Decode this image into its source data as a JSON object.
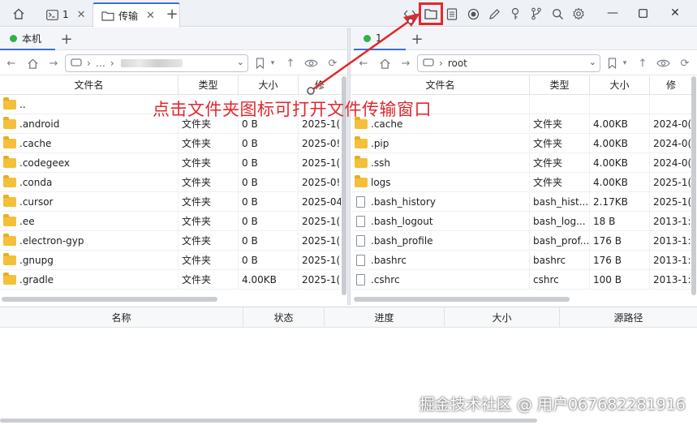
{
  "titlebar": {
    "tabs": [
      {
        "label": "1",
        "icon": "terminal-icon"
      },
      {
        "label": "传输",
        "icon": "folder-icon"
      }
    ],
    "toolbar_icons": [
      "code-icon",
      "folder-icon",
      "document-icon",
      "record-icon",
      "pencil-icon",
      "key-icon",
      "git-branch-icon",
      "search-icon",
      "gear-icon"
    ],
    "highlighted_icon": "folder-icon"
  },
  "left_pane": {
    "tab_label": "本机",
    "path": [
      "…"
    ],
    "columns": [
      "文件名",
      "类型",
      "大小",
      "修"
    ],
    "rows": [
      {
        "name": "..",
        "type": "",
        "size": "",
        "modified": "",
        "kind": "folder"
      },
      {
        "name": ".android",
        "type": "文件夹",
        "size": "0 B",
        "modified": "2025-1(",
        "kind": "folder"
      },
      {
        "name": ".cache",
        "type": "文件夹",
        "size": "0 B",
        "modified": "2025-0!",
        "kind": "folder"
      },
      {
        "name": ".codegeex",
        "type": "文件夹",
        "size": "0 B",
        "modified": "2025-1(",
        "kind": "folder"
      },
      {
        "name": ".conda",
        "type": "文件夹",
        "size": "0 B",
        "modified": "2025-0!",
        "kind": "folder"
      },
      {
        "name": ".cursor",
        "type": "文件夹",
        "size": "0 B",
        "modified": "2025-04",
        "kind": "folder"
      },
      {
        "name": ".ee",
        "type": "文件夹",
        "size": "0 B",
        "modified": "2025-1(",
        "kind": "folder"
      },
      {
        "name": ".electron-gyp",
        "type": "文件夹",
        "size": "0 B",
        "modified": "2025-1(",
        "kind": "folder"
      },
      {
        "name": ".gnupg",
        "type": "文件夹",
        "size": "0 B",
        "modified": "2025-1(",
        "kind": "folder"
      },
      {
        "name": ".gradle",
        "type": "文件夹",
        "size": "4.00KB",
        "modified": "2025-1(",
        "kind": "folder"
      }
    ]
  },
  "right_pane": {
    "tab_label": "1",
    "path": "root",
    "columns": [
      "文件名",
      "类型",
      "大小",
      "修"
    ],
    "rows": [
      {
        "name": "",
        "type": "",
        "size": "",
        "modified": "",
        "kind": "none"
      },
      {
        "name": ".cache",
        "type": "文件夹",
        "size": "4.00KB",
        "modified": "2024-0(",
        "kind": "folder"
      },
      {
        "name": ".pip",
        "type": "文件夹",
        "size": "4.00KB",
        "modified": "2024-0(",
        "kind": "folder"
      },
      {
        "name": ".ssh",
        "type": "文件夹",
        "size": "4.00KB",
        "modified": "2024-0(",
        "kind": "folder"
      },
      {
        "name": "logs",
        "type": "文件夹",
        "size": "4.00KB",
        "modified": "2025-1(",
        "kind": "folder"
      },
      {
        "name": ".bash_history",
        "type": "bash_hist...",
        "size": "2.17KB",
        "modified": "2025-1(",
        "kind": "file"
      },
      {
        "name": ".bash_logout",
        "type": "bash_log...",
        "size": "18 B",
        "modified": "2013-1:",
        "kind": "file"
      },
      {
        "name": ".bash_profile",
        "type": "bash_prof...",
        "size": "176 B",
        "modified": "2013-1:",
        "kind": "file"
      },
      {
        "name": ".bashrc",
        "type": "bashrc",
        "size": "176 B",
        "modified": "2013-1:",
        "kind": "file"
      },
      {
        "name": ".cshrc",
        "type": "cshrc",
        "size": "100 B",
        "modified": "2013-1:",
        "kind": "file"
      }
    ]
  },
  "queue": {
    "columns": [
      "名称",
      "状态",
      "进度",
      "大小",
      "源路径"
    ]
  },
  "annotation": {
    "text": "点击文件夹图标可打开文件传输窗口",
    "color": "#e0282e"
  },
  "watermark": "掘金技术社区 @ 用户067682281916",
  "colors": {
    "accent": "#3b6fd3",
    "online_dot": "#2fb34a",
    "folder": "#f4c03a"
  }
}
